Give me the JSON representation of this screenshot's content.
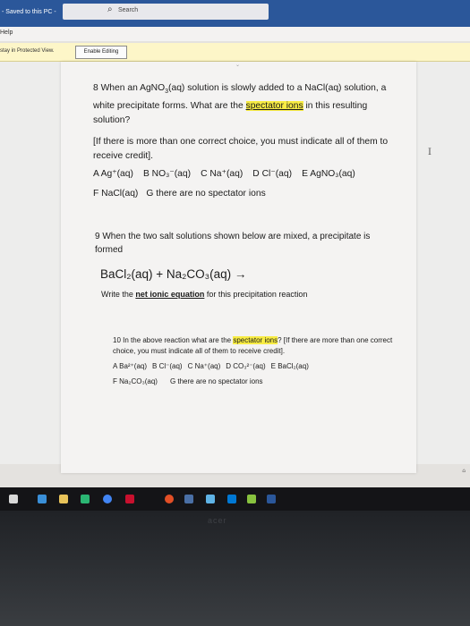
{
  "window": {
    "saved_status": "- Saved to this PC -",
    "search_placeholder": "Search",
    "menu_help": "Help",
    "protected_view_msg": "stay in Protected View.",
    "enable_editing_label": "Enable Editing"
  },
  "questions": {
    "q8": {
      "pre": "8 When an AgNO",
      "sub3": "3",
      "mid": "(aq) solution is slowly added to a NaCl(aq) solution, a white precipitate forms. What are the ",
      "highlight": "spectator ions",
      "post": " in this resulting solution?",
      "instructions": "[If there is more than one correct choice, you must indicate all of them to receive credit].",
      "choices_row1": [
        "A Ag⁺(aq)",
        "B NO₃⁻(aq)",
        "C Na⁺(aq)",
        "D Cl⁻(aq)",
        "E AgNO₃(aq)"
      ],
      "choices_row2": [
        "F NaCl(aq)",
        "G there are no spectator ions"
      ]
    },
    "q9": {
      "intro": "9 When the two salt solutions shown below are mixed, a precipitate is formed",
      "equation": "BaCl₂(aq) + Na₂CO₃(aq) →",
      "instr_pre": "Write the ",
      "instr_ul": "net ionic equation",
      "instr_post": " for this precipitation reaction"
    },
    "q10": {
      "pre": "10 In the above reaction what are the ",
      "highlight": "spectator ions",
      "post": "? [If there are more than one correct choice, you must indicate all of them to receive credit].",
      "choices_row1": [
        "A Ba²⁺(aq)",
        "B Cl⁻(aq)",
        "C Na⁺(aq)",
        "D CO₃²⁻(aq)",
        "E BaCl₂(aq)"
      ],
      "choices_row2": [
        "F Na₂CO₃(aq)",
        "G there are no spectator ions"
      ]
    }
  },
  "colors": {
    "title_bar": "#2b579a",
    "highlight": "#f8ec44",
    "protected_bar": "#fdf6c8"
  },
  "icons": [
    "search-icon",
    "windows-icon",
    "file-explorer-icon",
    "chrome-icon",
    "word-icon"
  ]
}
